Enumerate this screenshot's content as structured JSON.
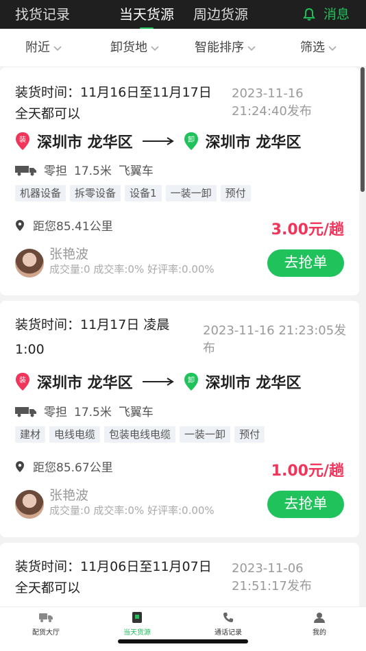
{
  "header": {
    "title": "找货记录",
    "tabs": [
      {
        "label": "当天货源",
        "active": true
      },
      {
        "label": "周边货源",
        "active": false
      }
    ],
    "message_label": "消息",
    "accent_color": "#21c05b"
  },
  "filters": [
    "附近",
    "卸货地",
    "智能排序",
    "筛选"
  ],
  "cards": [
    {
      "time_line1": "装货时间：11月16日至11月17日",
      "time_line2": "全天都可以",
      "publish_line1": "2023-11-16",
      "publish_line2": "21:24:40发布",
      "load_pin": "装",
      "unload_pin": "卸",
      "from": "深圳市 龙华区",
      "to": "深圳市 龙华区",
      "truck_type": "零担",
      "truck_length": "17.5米",
      "truck_kind": "飞翼车",
      "tags": [
        "机器设备",
        "拆零设备",
        "设备1",
        "一装一卸",
        "预付"
      ],
      "distance": "距您85.41公里",
      "price": "3.00元/趟",
      "user_name": "张艳波",
      "stats": "成交量:0  成交率:0%  好评率:0.00%",
      "button": "去抢单"
    },
    {
      "time_line1": "装货时间：11月17日 凌晨",
      "time_line2": "1:00",
      "publish_line1": "2023-11-16 21:23:05发",
      "publish_line2": "布",
      "load_pin": "装",
      "unload_pin": "卸",
      "from": "深圳市 龙华区",
      "to": "深圳市 龙华区",
      "truck_type": "零担",
      "truck_length": "17.5米",
      "truck_kind": "飞翼车",
      "tags": [
        "建材",
        "电线电缆",
        "包装电线电缆",
        "一装一卸",
        "预付"
      ],
      "distance": "距您85.67公里",
      "price": "1.00元/趟",
      "user_name": "张艳波",
      "stats": "成交量:0  成交率:0%  好评率:0.00%",
      "button": "去抢单"
    },
    {
      "time_line1": "装货时间：11月06日至11月07日",
      "time_line2": "全天都可以",
      "publish_line1": "2023-11-06",
      "publish_line2": "21:51:17发布"
    }
  ],
  "tabbar": [
    {
      "label": "配货大厅",
      "icon": "truck-icon",
      "active": false
    },
    {
      "label": "当天货源",
      "icon": "goods-icon",
      "active": true
    },
    {
      "label": "通话记录",
      "icon": "phone-icon",
      "active": false
    },
    {
      "label": "我的",
      "icon": "user-icon",
      "active": false
    }
  ],
  "colors": {
    "price": "#f0345a",
    "button": "#1fc25b",
    "load_pin": "#f0345a",
    "unload_pin": "#1fc25b"
  }
}
